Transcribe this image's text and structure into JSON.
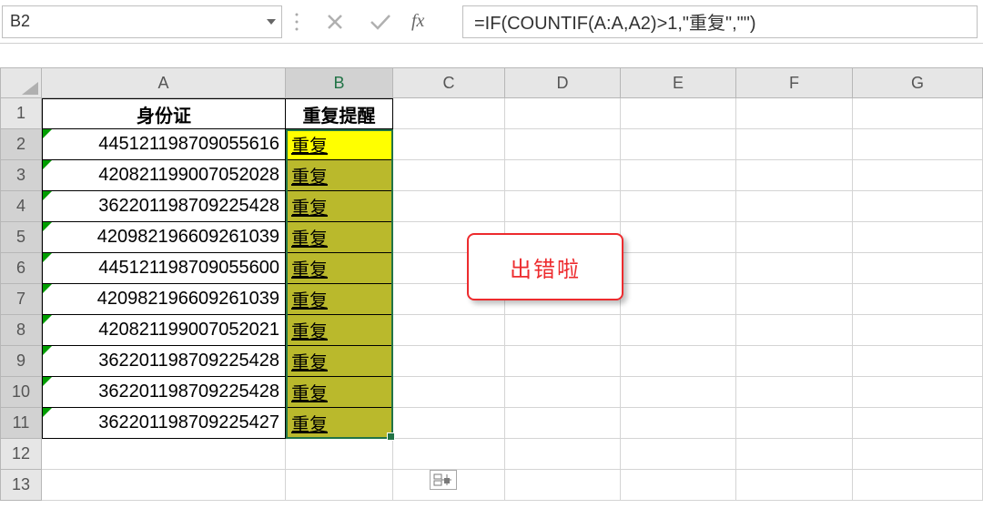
{
  "nameBox": {
    "value": "B2"
  },
  "formulaBar": {
    "value": "=IF(COUNTIF(A:A,A2)>1,\"重复\",\"\")",
    "fxLabel": "fx"
  },
  "columns": [
    "A",
    "B",
    "C",
    "D",
    "E",
    "F",
    "G"
  ],
  "activeColumn": "B",
  "rowNumbers": [
    "1",
    "2",
    "3",
    "4",
    "5",
    "6",
    "7",
    "8",
    "9",
    "10",
    "11",
    "12",
    "13"
  ],
  "headers": {
    "colA": "身份证",
    "colB": "重复提醒"
  },
  "data": [
    {
      "id": "445121198709055616",
      "dup": "重复"
    },
    {
      "id": "420821199007052028",
      "dup": "重复"
    },
    {
      "id": "362201198709225428",
      "dup": "重复"
    },
    {
      "id": "420982196609261039",
      "dup": "重复"
    },
    {
      "id": "445121198709055600",
      "dup": "重复"
    },
    {
      "id": "420982196609261039",
      "dup": "重复"
    },
    {
      "id": "420821199007052021",
      "dup": "重复"
    },
    {
      "id": "362201198709225428",
      "dup": "重复"
    },
    {
      "id": "362201198709225428",
      "dup": "重复"
    },
    {
      "id": "362201198709225427",
      "dup": "重复"
    }
  ],
  "callout": {
    "text": "出错啦"
  }
}
